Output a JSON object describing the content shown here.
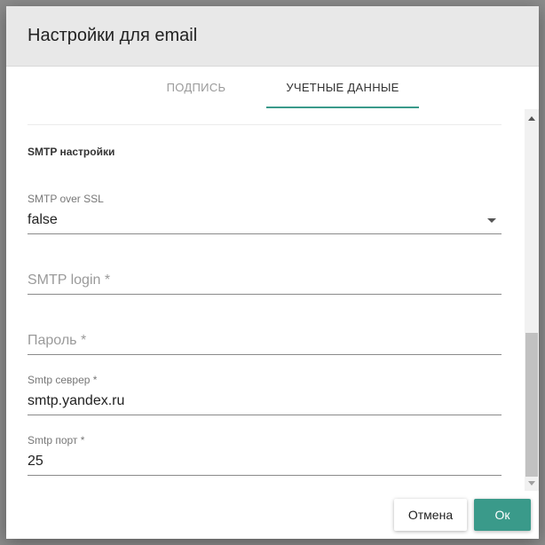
{
  "dialog": {
    "title": "Настройки для email"
  },
  "tabs": [
    {
      "label": "ПОДПИСЬ",
      "active": false
    },
    {
      "label": "УЧЕТНЫЕ ДАННЫЕ",
      "active": true
    }
  ],
  "section": {
    "title": "SMTP настройки"
  },
  "fields": {
    "ssl": {
      "label": "SMTP over SSL",
      "value": "false"
    },
    "login": {
      "placeholder": "SMTP login *",
      "value": ""
    },
    "password": {
      "placeholder": "Пароль *",
      "value": ""
    },
    "server": {
      "label": "Smtp севрер *",
      "value": "smtp.yandex.ru"
    },
    "port": {
      "label": "Smtp порт *",
      "value": "25"
    }
  },
  "footer": {
    "cancel_label": "Отмена",
    "ok_label": "Ок"
  },
  "colors": {
    "accent": "#3a9a8a",
    "header_bg": "#e8e8e8"
  },
  "icons": {
    "select_arrow": "chevron-down-icon",
    "scroll_up": "arrow-up-icon",
    "scroll_down": "arrow-down-icon"
  }
}
